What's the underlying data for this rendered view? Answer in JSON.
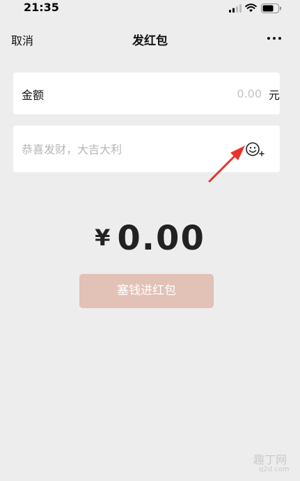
{
  "status_bar": {
    "time": "21:35"
  },
  "nav": {
    "cancel_label": "取消",
    "title": "发红包",
    "more_icon": "more-icon"
  },
  "amount": {
    "label": "金额",
    "placeholder": "0.00",
    "unit": "元"
  },
  "greeting": {
    "placeholder": "恭喜发财，大吉大利",
    "emoji_icon": "emoji-add-icon"
  },
  "total": {
    "currency": "¥",
    "value": "0.00"
  },
  "submit": {
    "label": "塞钱进红包",
    "color": "#e2c1b6"
  },
  "watermark": {
    "text": "趣丁网",
    "site": "q2d.com"
  },
  "colors": {
    "background": "#ededed",
    "card": "#ffffff",
    "annotation_arrow": "#e8322b"
  }
}
